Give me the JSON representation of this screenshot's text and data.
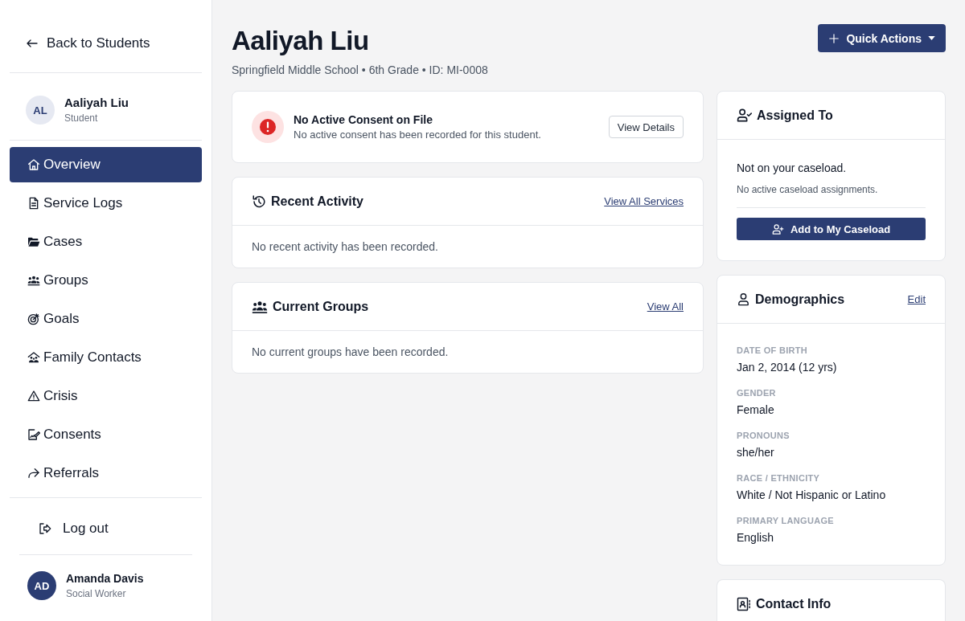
{
  "sidebar": {
    "back_link": "Back to Students",
    "student": {
      "initials": "AL",
      "name": "Aaliyah Liu",
      "role": "Student"
    },
    "nav_items": [
      {
        "label": "Overview",
        "selected": true
      },
      {
        "label": "Service Logs",
        "selected": false
      },
      {
        "label": "Cases",
        "selected": false
      },
      {
        "label": "Groups",
        "selected": false
      },
      {
        "label": "Goals",
        "selected": false
      },
      {
        "label": "Family Contacts",
        "selected": false
      },
      {
        "label": "Crisis",
        "selected": false
      },
      {
        "label": "Consents",
        "selected": false
      },
      {
        "label": "Referrals",
        "selected": false
      }
    ],
    "logout": "Log out",
    "user": {
      "initials": "AD",
      "name": "Amanda Davis",
      "role": "Social Worker"
    }
  },
  "header": {
    "title": "Aaliyah Liu",
    "subtitle": "Springfield Middle School • 6th Grade • ID: MI-0008",
    "quick_actions": "Quick Actions"
  },
  "consent_alert": {
    "title": "No Active Consent on File",
    "message": "No active consent has been recorded for this student.",
    "button": "View Details"
  },
  "panels": [
    {
      "title": "Recent Activity",
      "link": "View All Services",
      "empty_message": "No recent activity has been recorded."
    },
    {
      "title": "Current Groups",
      "link": "View All",
      "empty_message": "No current groups have been recorded."
    }
  ],
  "assigned_to": {
    "title": "Assigned To",
    "status": "Not on your caseload.",
    "note": "No active caseload assignments.",
    "button": "Add to My Caseload"
  },
  "demographics": {
    "title": "Demographics",
    "edit_link": "Edit",
    "fields": [
      {
        "label": "DATE OF BIRTH",
        "value": "Jan 2, 2014 (12 yrs)"
      },
      {
        "label": "GENDER",
        "value": "Female"
      },
      {
        "label": "PRONOUNS",
        "value": "she/her"
      },
      {
        "label": "RACE / ETHNICITY",
        "value": "White / Not Hispanic or Latino"
      },
      {
        "label": "PRIMARY LANGUAGE",
        "value": "English"
      }
    ]
  },
  "contact_info": {
    "title": "Contact Info"
  }
}
